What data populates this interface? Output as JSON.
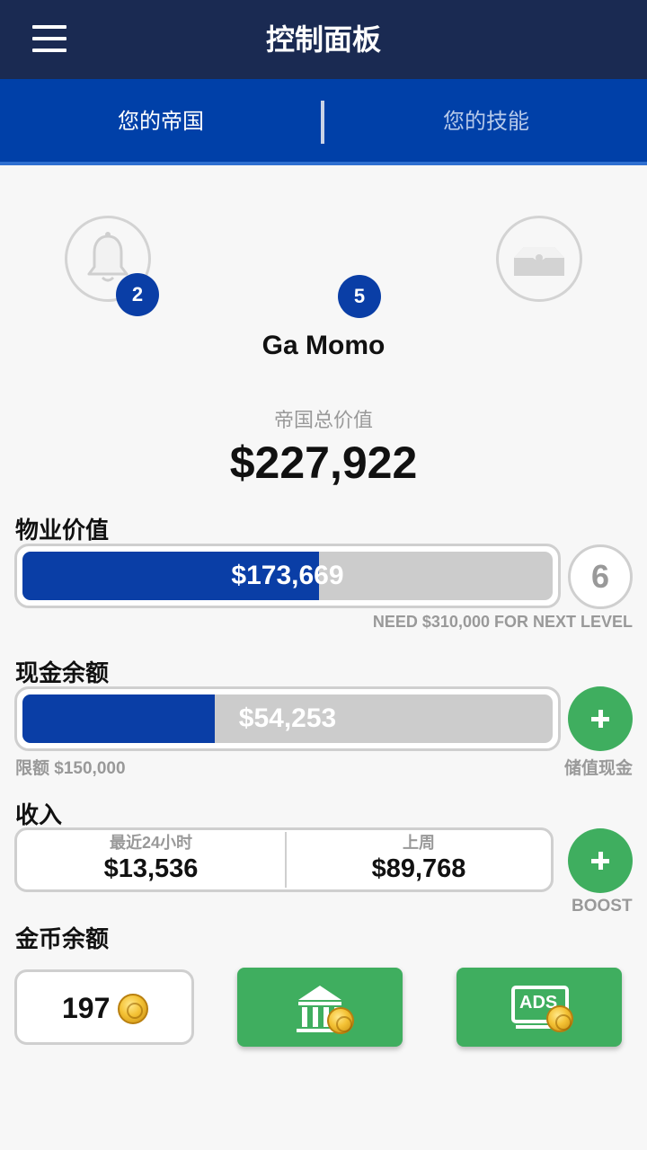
{
  "header": {
    "title": "控制面板",
    "menu_icon": "hamburger-menu-icon"
  },
  "tabs": [
    {
      "label": "您的帝国",
      "active": true
    },
    {
      "label": "您的技能",
      "active": false
    }
  ],
  "profile": {
    "notification_count": "2",
    "level_badge": "5",
    "name": "Ga Momo"
  },
  "empire": {
    "total_label": "帝国总价值",
    "total_value": "$227,922"
  },
  "property": {
    "label": "物业价值",
    "value": "$173,669",
    "progress": 0.56,
    "level": "6",
    "next_level_text": "NEED $310,000 FOR NEXT LEVEL"
  },
  "cash": {
    "label": "现金余额",
    "value": "$54,253",
    "progress": 0.362,
    "limit_text": "限额  $150,000",
    "store_label": "储值现金"
  },
  "income": {
    "label": "收入",
    "last24_label": "最近24小时",
    "last24_value": "$13,536",
    "last_week_label": "上周",
    "last_week_value": "$89,768",
    "boost_label": "BOOST"
  },
  "coins": {
    "label": "金币余额",
    "count": "197",
    "ads_text": "ADS"
  },
  "colors": {
    "navy": "#1a2a52",
    "blue": "#0040a8",
    "fill": "#0a3ea6",
    "green": "#3fae5f"
  }
}
